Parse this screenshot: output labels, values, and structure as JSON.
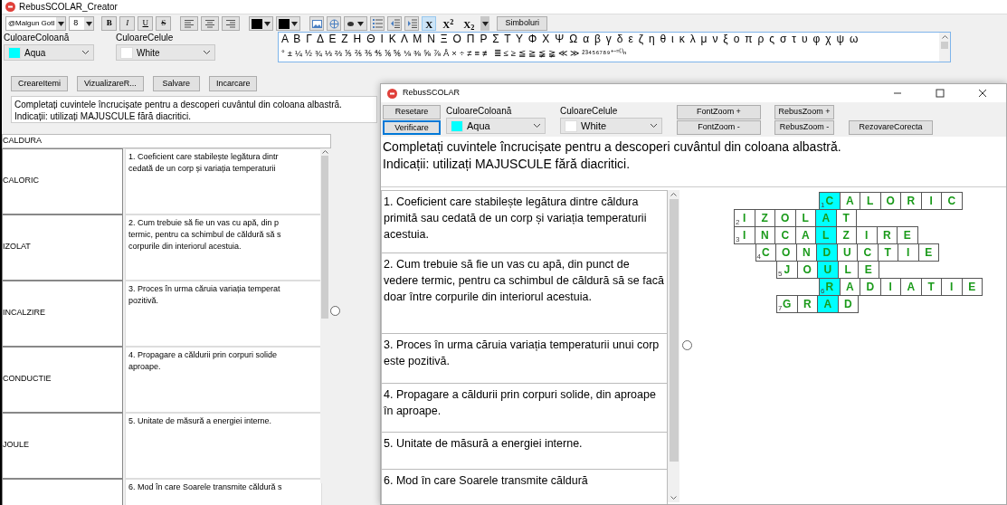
{
  "creator_window": {
    "title": "RebusSCOLAR_Creator",
    "toolbar": {
      "font": "@Malgun Gotl",
      "size": "8",
      "format_buttons": [
        {
          "kind": "bold",
          "label": "B"
        },
        {
          "kind": "italic",
          "label": "I"
        },
        {
          "kind": "underline",
          "label": "U"
        },
        {
          "kind": "strike",
          "label": "S"
        }
      ],
      "script_buttons": [
        {
          "label": "X",
          "selected": true
        },
        {
          "label": "X$^{2}$",
          "selected": false
        },
        {
          "label": "X$_{2}$",
          "selected": false
        }
      ],
      "symbols_button": "Simboluri"
    },
    "symbols": [
      "Α Β Γ Δ Ε Ζ Η Θ Ι Κ Λ Μ Ν Ξ Ο Π Ρ Σ Τ Υ Φ Χ Ψ Ω  α β γ δ ε ζ η θ ι κ λ μ ν ξ ο π ρ ς σ τ υ φ χ ψ ω",
      "° ± ¼ ½ ¾ ⅓ ⅔ ⅕ ⅖ ⅗ ⅘ ⅙ ⅚ ⅛ ⅜ ⅝ ⅞ Å × ÷ ≠ ≡ ≢ ≣ ≤ ≥ ≦ ≧ ≨ ≩ ≪ ≫ ²³⁴⁵⁶⁷⁸⁹⁺⁻⁼⁽⁾ⁿ"
    ],
    "column_color": {
      "label": "CuloareColoană",
      "value": "Aqua",
      "color": "#00ffff"
    },
    "cell_color": {
      "label": "CuloareCelule",
      "value": "White",
      "color": "#ffffff"
    },
    "buttons": [
      "CreareItemi",
      "VizualizareR...",
      "Salvare",
      "Incarcare"
    ],
    "instructions": [
      "Completați cuvintele încrucișate pentru a descoperi cuvântul din coloana albastră.",
      "Indicații: utilizați MAJUSCULE fără diacritici."
    ],
    "key_word": "CALDURA",
    "rows": [
      {
        "word": "CALORIC",
        "clue_lines": [
          "1.  Coeficient care stabilește legătura dintr",
          "cedată de un corp și variația temperaturii"
        ]
      },
      {
        "word": "IZOLAT",
        "clue_lines": [
          "2.  Cum trebuie să fie un vas cu apă, din p",
          "termic, pentru ca schimbul de căldură să s",
          "corpurile din interiorul acestuia."
        ]
      },
      {
        "word": "INCALZIRE",
        "clue_lines": [
          "3.  Proces în urma căruia variația temperat",
          "pozitivă."
        ]
      },
      {
        "word": "CONDUCTIE",
        "clue_lines": [
          "4.  Propagare a căldurii prin corpuri solide",
          "aproape."
        ]
      },
      {
        "word": "JOULE",
        "clue_lines": [
          "5.  Unitate de măsură a energiei interne."
        ]
      },
      {
        "word": "",
        "clue_lines": [
          "6. Mod în care Soarele transmite căldură s"
        ]
      }
    ]
  },
  "player_window": {
    "title": "RebusSCOLAR",
    "buttons_left": [
      {
        "label": "Resetare",
        "focused": false
      },
      {
        "label": "Verificare",
        "focused": true
      }
    ],
    "column_color": {
      "label": "CuloareColoană",
      "value": "Aqua",
      "color": "#00ffff"
    },
    "cell_color": {
      "label": "CuloareCelule",
      "value": "White",
      "color": "#ffffff"
    },
    "font_zoom": [
      "FontZoom +",
      "FontZoom -"
    ],
    "rebus_zoom": [
      "RebusZoom +",
      "RebusZoom -"
    ],
    "solve_button": "RezovareCorecta",
    "instructions": [
      "Completați cuvintele încrucișate pentru a descoperi cuvântul din coloana albastră.",
      "Indicații: utilizați MAJUSCULE fără diacritici."
    ],
    "clues": [
      "1.  Coeficient care stabilește legătura dintre căldura primită sau cedată de un corp și variația temperaturii acestuia.",
      "2.  Cum trebuie să fie un vas cu apă, din punct de vedere termic, pentru ca schimbul de căldură să se facă doar între corpurile din interiorul acestuia.",
      "3.  Proces în urma căruia variația temperaturii unui corp este pozitivă.",
      "4.  Propagare a căldurii prin corpuri solide, din aproape în aproape.",
      "5.  Unitate de măsură a energiei interne.",
      "6. Mod în care Soarele transmite căldură"
    ],
    "crossword": {
      "rows": [
        {
          "number": "1",
          "before": [],
          "key": "C",
          "after": [
            "A",
            "L",
            "O",
            "R",
            "I",
            "C"
          ]
        },
        {
          "number": "2",
          "before": [
            "I",
            "Z",
            "O",
            "L"
          ],
          "key": "A",
          "after": [
            "T"
          ]
        },
        {
          "number": "3",
          "before": [
            "I",
            "N",
            "C",
            "A"
          ],
          "key": "L",
          "after": [
            "Z",
            "I",
            "R",
            "E"
          ]
        },
        {
          "number": "4",
          "before": [
            "C",
            "O",
            "N"
          ],
          "key": "D",
          "after": [
            "U",
            "C",
            "T",
            "I",
            "E"
          ]
        },
        {
          "number": "5",
          "before": [
            "J",
            "O"
          ],
          "key": "U",
          "after": [
            "L",
            "E"
          ]
        },
        {
          "number": "6",
          "before": [],
          "key": "R",
          "after": [
            "A",
            "D",
            "I",
            "A",
            "T",
            "I",
            "E"
          ]
        },
        {
          "number": "7",
          "before": [
            "G",
            "R"
          ],
          "key": "A",
          "after": [
            "D"
          ]
        }
      ]
    }
  }
}
